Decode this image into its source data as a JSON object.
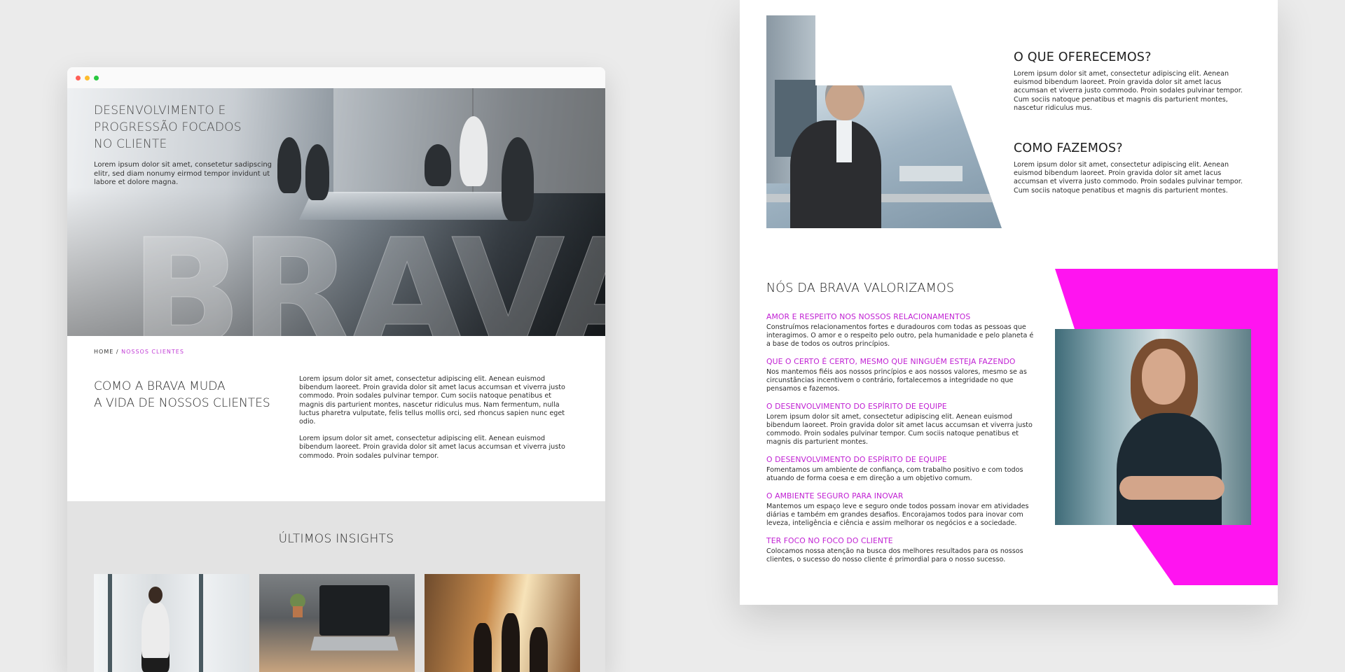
{
  "left_mockup": {
    "hero": {
      "title": "DESENVOLVIMENTO E\nPROGRESSÃO FOCADOS\nNO CLIENTE",
      "text": "Lorem ipsum dolor sit amet, consetetur sadipscing elitr, sed diam nonumy eirmod tempor invidunt ut labore et dolore magna.",
      "wordmark": "BRAVA"
    },
    "breadcrumb": {
      "home": "HOME",
      "separator": "/",
      "current": "NOSSOS CLIENTES"
    },
    "section": {
      "title": "COMO A BRAVA MUDA\nA VIDA DE NOSSOS CLIENTES",
      "paragraphs": [
        "Lorem ipsum dolor sit amet, consectetur adipiscing elit. Aenean euismod bibendum laoreet. Proin gravida dolor sit amet lacus accumsan et viverra justo commodo. Proin sodales pulvinar tempor. Cum sociis natoque penatibus et magnis dis parturient montes, nascetur ridiculus mus. Nam fermentum, nulla luctus pharetra vulputate, felis tellus mollis orci, sed rhoncus sapien nunc eget odio.",
        "Lorem ipsum dolor sit amet, consectetur adipiscing elit. Aenean euismod bibendum laoreet. Proin gravida dolor sit amet lacus accumsan et viverra justo commodo. Proin sodales pulvinar tempor."
      ]
    },
    "insights": {
      "title": "ÚLTIMOS INSIGHTS"
    }
  },
  "right_mockup": {
    "offer": {
      "title": "O QUE OFERECEMOS?",
      "text": "Lorem ipsum dolor sit amet, consectetur adipiscing elit. Aenean euismod bibendum laoreet. Proin gravida dolor sit amet lacus accumsan et viverra justo commodo. Proin sodales pulvinar tempor. Cum sociis natoque penatibus et magnis dis parturient montes, nascetur ridiculus mus."
    },
    "how": {
      "title": "COMO FAZEMOS?",
      "text": "Lorem ipsum dolor sit amet, consectetur adipiscing elit. Aenean euismod bibendum laoreet. Proin gravida dolor sit amet lacus accumsan et viverra justo commodo. Proin sodales pulvinar tempor. Cum sociis natoque penatibus et magnis dis parturient montes."
    },
    "values": {
      "title": "NÓS DA BRAVA VALORIZAMOS",
      "items": [
        {
          "heading": "AMOR E RESPEITO NOS NOSSOS RELACIONAMENTOS",
          "text": "Construímos relacionamentos fortes e duradouros com todas as pessoas que interagimos. O amor e o respeito pelo outro, pela humanidade e pelo planeta é a base de todos os outros princípios."
        },
        {
          "heading": "QUE O CERTO É CERTO, MESMO QUE NINGUÉM ESTEJA FAZENDO",
          "text": "Nos mantemos fiéis aos nossos princípios e aos nossos valores, mesmo se as circunstâncias incentivem o contrário, fortalecemos a integridade no que pensamos e fazemos."
        },
        {
          "heading": "O DESENVOLVIMENTO DO ESPÍRITO DE EQUIPE",
          "text": "Lorem ipsum dolor sit amet, consectetur adipiscing elit. Aenean euismod bibendum laoreet. Proin gravida dolor sit amet lacus accumsan et viverra justo commodo. Proin sodales pulvinar tempor. Cum sociis natoque penatibus et magnis dis parturient montes."
        },
        {
          "heading": "O DESENVOLVIMENTO DO ESPÍRITO DE EQUIPE",
          "text": "Fomentamos um ambiente de confiança, com trabalho positivo e com todos atuando de forma coesa e em direção a um objetivo comum."
        },
        {
          "heading": "O AMBIENTE SEGURO PARA INOVAR",
          "text": "Mantemos um espaço leve e seguro onde todos possam inovar em atividades diárias e também em grandes desafios. Encorajamos todos para inovar com leveza, inteligência e ciência e assim melhorar os negócios e a sociedade."
        },
        {
          "heading": "TER FOCO NO FOCO DO CLIENTE",
          "text": "Colocamos nossa atenção na busca dos melhores resultados para os nossos clientes, o sucesso do nosso cliente é primordial para o nosso sucesso."
        }
      ]
    }
  },
  "colors": {
    "accent": "#c01fd3",
    "magenta_block": "#ff14f0",
    "background": "#ebebeb"
  }
}
